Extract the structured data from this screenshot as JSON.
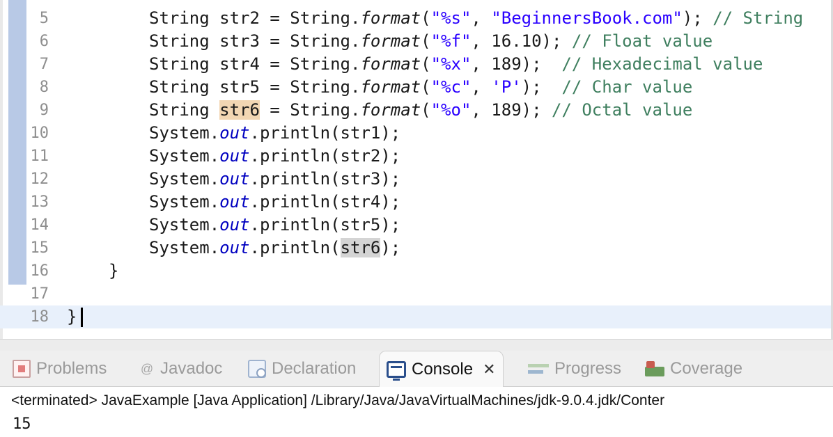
{
  "editor": {
    "lines": [
      {
        "n": "5",
        "text": "String str2 = String.format(\"%s\", \"BeginnersBook.com\"); // String"
      },
      {
        "n": "6",
        "text": "String str3 = String.format(\"%f\", 16.10); // Float value"
      },
      {
        "n": "7",
        "text": "String str4 = String.format(\"%x\", 189);  // Hexadecimal value"
      },
      {
        "n": "8",
        "text": "String str5 = String.format(\"%c\", 'P');  // Char value"
      },
      {
        "n": "9",
        "text": "String str6 = String.format(\"%o\", 189); // Octal value"
      },
      {
        "n": "10",
        "text": "System.out.println(str1);"
      },
      {
        "n": "11",
        "text": "System.out.println(str2);"
      },
      {
        "n": "12",
        "text": "System.out.println(str3);"
      },
      {
        "n": "13",
        "text": "System.out.println(str4);"
      },
      {
        "n": "14",
        "text": "System.out.println(str5);"
      },
      {
        "n": "15",
        "text": "System.out.println(str6);"
      },
      {
        "n": "16",
        "text": "}"
      },
      {
        "n": "17",
        "text": ""
      },
      {
        "n": "18",
        "text": "}"
      }
    ],
    "current_line": "18"
  },
  "tabs": [
    {
      "label": "Problems",
      "icon": "problems-icon"
    },
    {
      "label": "Javadoc",
      "icon": "javadoc-icon"
    },
    {
      "label": "Declaration",
      "icon": "declaration-icon"
    },
    {
      "label": "Console",
      "icon": "console-icon",
      "active": true
    },
    {
      "label": "Progress",
      "icon": "progress-icon"
    },
    {
      "label": "Coverage",
      "icon": "coverage-icon"
    }
  ],
  "console": {
    "status": "<terminated> JavaExample [Java Application] /Library/Java/JavaVirtualMachines/jdk-9.0.4.jdk/Conter",
    "output": [
      "15"
    ]
  },
  "colors": {
    "keyword": "#7f0055",
    "string": "#2a00ff",
    "comment": "#3f7f5f",
    "field": "#0000c0",
    "change_bar": "#b8c9e6",
    "current_line": "#e8f0fb"
  }
}
